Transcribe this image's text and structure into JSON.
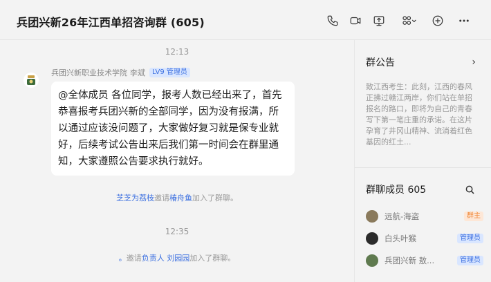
{
  "header": {
    "title": "兵团兴新26年江西单招咨询群 (605)",
    "icons": [
      "phone-icon",
      "video-icon",
      "screen-share-icon",
      "apps-menu-icon",
      "add-icon",
      "more-icon"
    ]
  },
  "chat": {
    "time1": "12:13",
    "sender_name": "兵团兴新职业技术学院",
    "sender_nick": "李斌",
    "sender_badge": "LV9 管理员",
    "message": "@全体成员 各位同学，报考人数已经出来了，首先恭喜报考兵团兴新的全部同学，因为没有报满，所以通过应该没问题了，大家做好复习就是保专业就好，后续考试公告出来后我们第一时间会在群里通知，大家遵照公告要求执行就好。",
    "sys1": {
      "actor": "芝芝为荔枝",
      "verb": "邀请",
      "target": "椿舟鱼",
      "suffix": "加入了群聊。"
    },
    "time2": "12:35",
    "sys2": {
      "actor": "。",
      "verb": "邀请",
      "target": "负责人 刘园园",
      "suffix": "加入了群聊。"
    }
  },
  "panel": {
    "notice_title": "群公告",
    "notice_arrow": "›",
    "notice_text": "致江西考生：此刻，江西的春风正拂过赣江两岸，你们站在单招报名的路口，即将为自己的青春写下第一笔庄重的承诺。在这片孕育了井冈山精神、流淌着红色基因的红土...",
    "members_title": "群聊成员 605",
    "members": [
      {
        "name": "远航-海盗",
        "tag": "群主",
        "tag_type": "owner",
        "avatar_color": "#8a7a5c"
      },
      {
        "name": "白头叶猴",
        "tag": "管理员",
        "tag_type": "admin",
        "avatar_color": "#2b2b2b"
      },
      {
        "name": "兵团兴新 敖...",
        "tag": "管理员",
        "tag_type": "admin",
        "avatar_color": "#5f7a4f"
      }
    ]
  }
}
